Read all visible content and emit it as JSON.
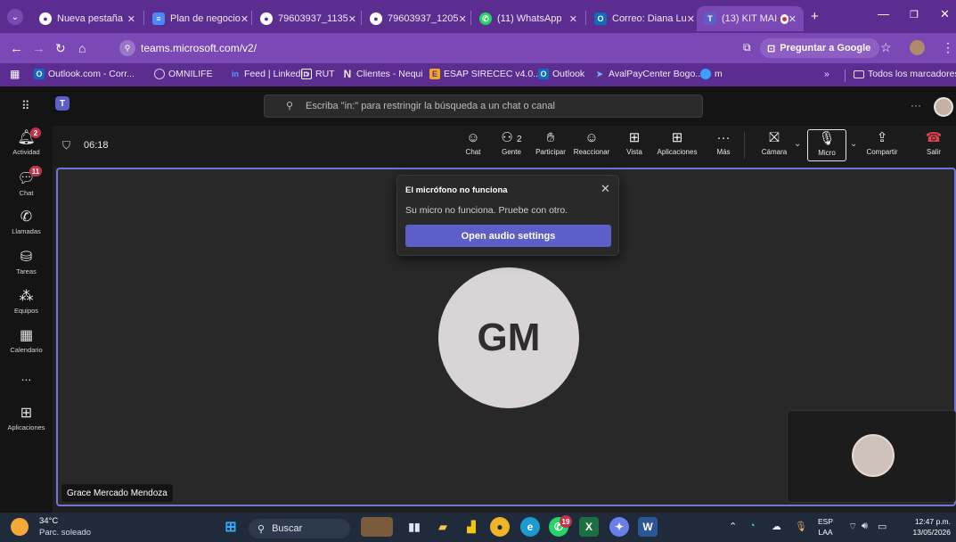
{
  "browser": {
    "tabs": [
      {
        "label": "Nueva pestaña",
        "icon": "chrome-icon"
      },
      {
        "label": "Plan de negocio",
        "icon": "docs-icon"
      },
      {
        "label": "79603937_1135",
        "icon": "chrome-icon"
      },
      {
        "label": "79603937_1205",
        "icon": "chrome-icon"
      },
      {
        "label": "(11) WhatsApp",
        "icon": "whatsapp-icon"
      },
      {
        "label": "Correo: Diana Lu",
        "icon": "outlook-icon"
      },
      {
        "label": "(13) KIT MAI",
        "icon": "teams-icon"
      }
    ],
    "url": "teams.microsoft.com/v2/",
    "google_button": "Preguntar a Google",
    "bookmarks": [
      {
        "label": "Outlook.com - Corr...",
        "icon": "outlook-icon"
      },
      {
        "label": "OMNILIFE",
        "icon": "globe-icon"
      },
      {
        "label": "Feed | LinkedIn",
        "icon": "linkedin-icon"
      },
      {
        "label": "RUT",
        "icon": "rut-icon"
      },
      {
        "label": "Clientes - Nequi",
        "icon": "nequi-icon"
      },
      {
        "label": "ESAP SIRECEC v4.0...",
        "icon": "esap-icon"
      },
      {
        "label": "Outlook",
        "icon": "outlook-icon"
      },
      {
        "label": "AvalPayCenter Bogo...",
        "icon": "aval-icon"
      },
      {
        "label": "m",
        "icon": "m-icon"
      }
    ],
    "all_bookmarks": "Todos los marcadores",
    "overflow": "»"
  },
  "teams": {
    "search_placeholder": "Escriba \"in:\" para restringir la búsqueda a un chat o canal",
    "rail": [
      {
        "label": "Actividad",
        "badge": "2"
      },
      {
        "label": "Chat",
        "badge": "11"
      },
      {
        "label": "Llamadas",
        "badge": ""
      },
      {
        "label": "Tareas",
        "badge": ""
      },
      {
        "label": "Equipos",
        "badge": ""
      },
      {
        "label": "Calendario",
        "badge": ""
      },
      {
        "label": "...",
        "badge": ""
      },
      {
        "label": "Aplicaciones",
        "badge": ""
      }
    ],
    "timer": "06:18",
    "toolbar": {
      "chat": "Chat",
      "people": "Gente",
      "people_count": "2",
      "raise": "Participar",
      "react": "Reaccionar",
      "view": "Vista",
      "apps": "Aplicaciones",
      "more": "Más",
      "camera": "Cámara",
      "mic": "Micro",
      "share": "Compartir",
      "leave": "Salir"
    },
    "popup": {
      "title": "El micrófono no funciona",
      "message": "Su micro no funciona. Pruebe con otro.",
      "button": "Open audio settings"
    },
    "participant": {
      "initials": "GM",
      "name": "Grace Mercado Mendoza"
    }
  },
  "taskbar": {
    "weather_temp": "34°C",
    "weather_desc": "Parc. soleado",
    "search": "Buscar",
    "whatsapp_badge": "19",
    "lang1": "ESP",
    "lang2": "LAA",
    "time": "12:47 p.m.",
    "date": "13/05/2026"
  },
  "colors": {
    "browser_frame": "#5b2d91",
    "teams_accent": "#5b5fc7",
    "leave_red": "#e0444b"
  }
}
